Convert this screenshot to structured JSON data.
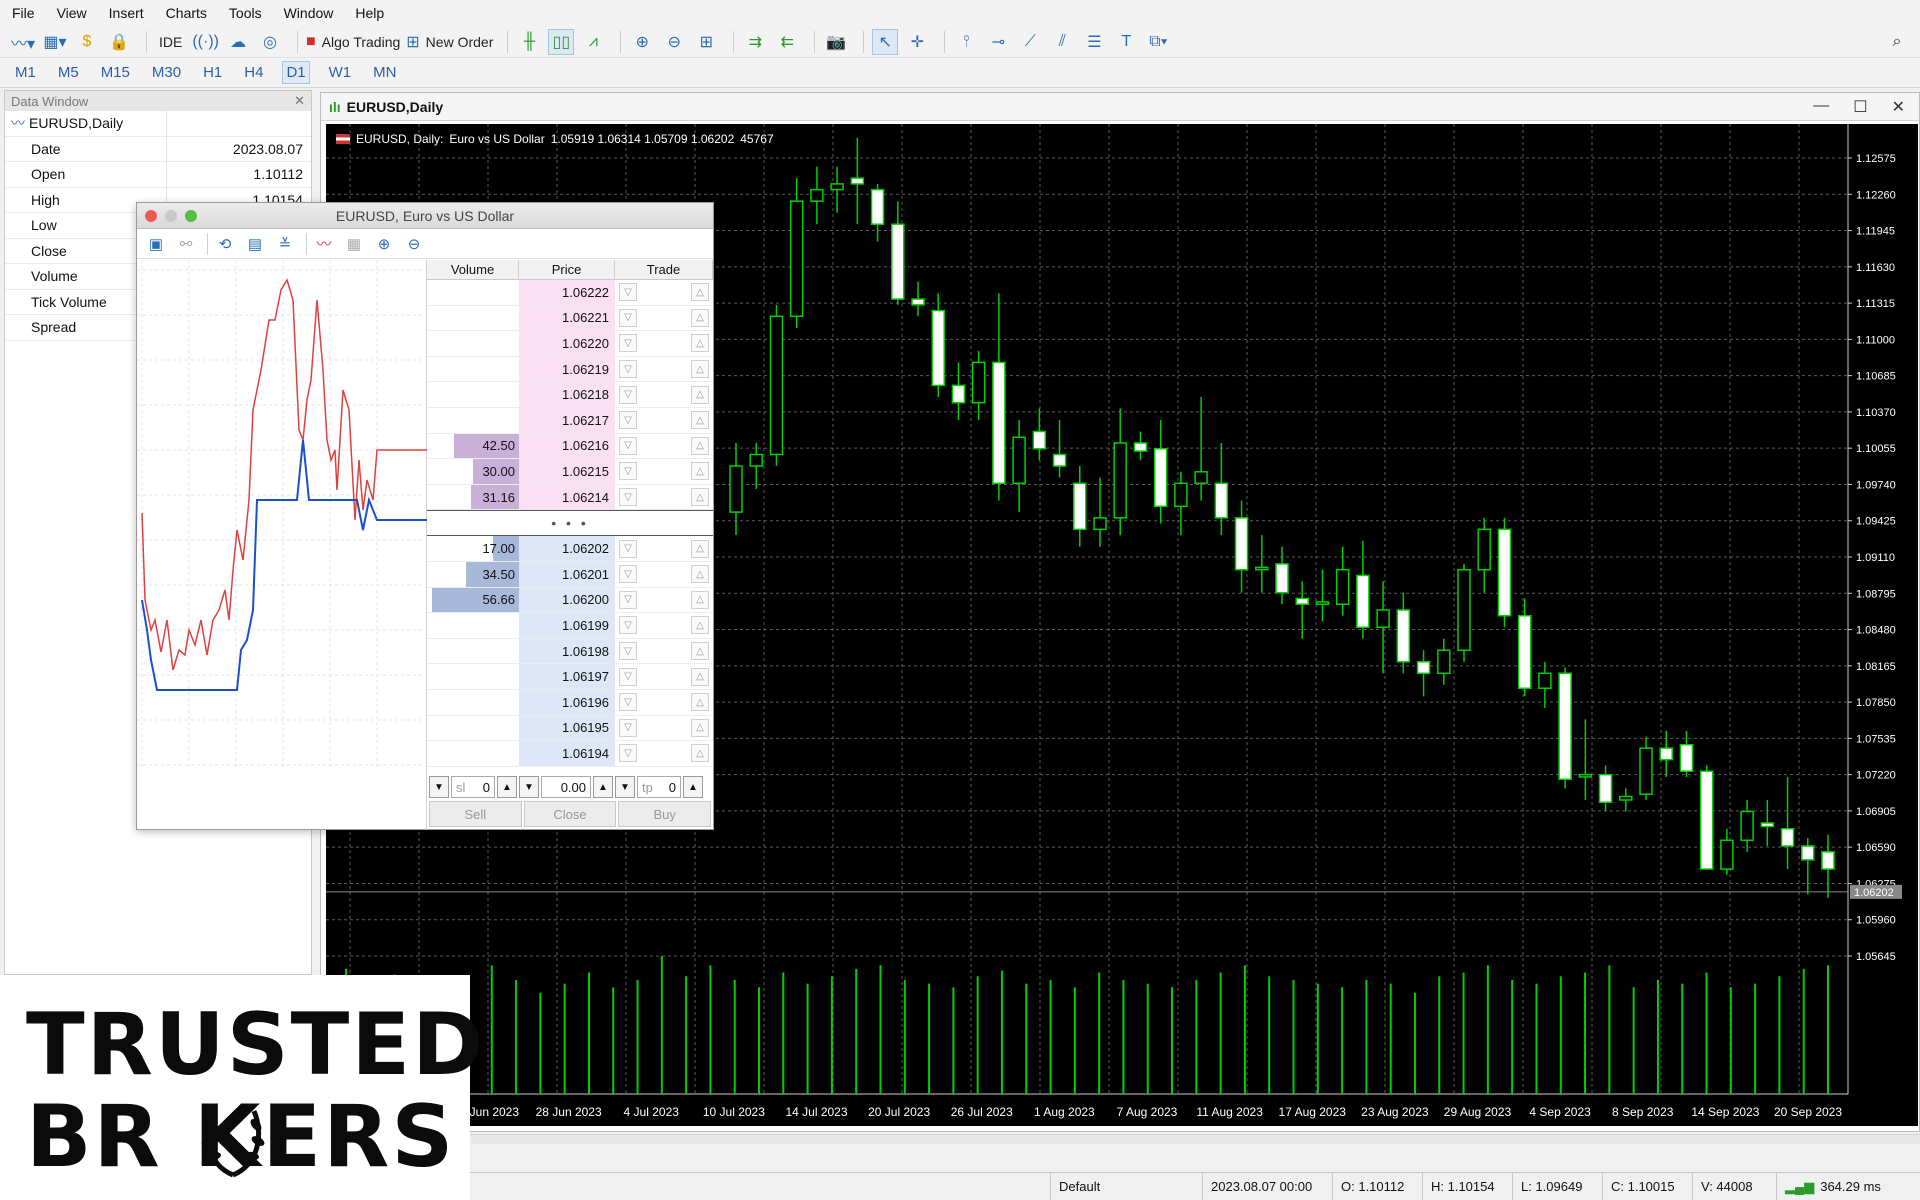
{
  "menu": [
    "File",
    "View",
    "Insert",
    "Charts",
    "Tools",
    "Window",
    "Help"
  ],
  "toolbar": {
    "ide_label": "IDE",
    "algo_trading_label": "Algo Trading",
    "new_order_label": "New Order"
  },
  "timeframes": [
    "M1",
    "M5",
    "M15",
    "M30",
    "H1",
    "H4",
    "D1",
    "W1",
    "MN"
  ],
  "active_timeframe": "D1",
  "data_window": {
    "title": "Data Window",
    "symbol": "EURUSD,Daily",
    "rows": [
      {
        "k": "Date",
        "v": "2023.08.07"
      },
      {
        "k": "Open",
        "v": "1.10112"
      },
      {
        "k": "High",
        "v": "1.10154"
      },
      {
        "k": "Low",
        "v": ""
      },
      {
        "k": "Close",
        "v": ""
      },
      {
        "k": "Volume",
        "v": ""
      },
      {
        "k": "Tick Volume",
        "v": ""
      },
      {
        "k": "Spread",
        "v": ""
      }
    ]
  },
  "chart_window": {
    "title": "EURUSD,Daily",
    "label_symbol": "EURUSD, Daily:",
    "label_desc": "Euro vs US Dollar",
    "label_ohlc": "1.05919 1.06314 1.05709 1.06202",
    "label_vol": "45767",
    "current_price": "1.06202"
  },
  "chart_data": {
    "type": "candlestick",
    "price_ticks": [
      "1.12575",
      "1.12260",
      "1.11945",
      "1.11630",
      "1.11315",
      "1.11000",
      "1.10685",
      "1.10370",
      "1.10055",
      "1.09740",
      "1.09425",
      "1.09110",
      "1.08795",
      "1.08480",
      "1.08165",
      "1.07850",
      "1.07535",
      "1.07220",
      "1.06905",
      "1.06590",
      "1.06275",
      "1.05960",
      "1.05645"
    ],
    "date_ticks": [
      "22 Jun 2023",
      "28 Jun 2023",
      "4 Jul 2023",
      "10 Jul 2023",
      "14 Jul 2023",
      "20 Jul 2023",
      "26 Jul 2023",
      "1 Aug 2023",
      "7 Aug 2023",
      "11 Aug 2023",
      "17 Aug 2023",
      "23 Aug 2023",
      "29 Aug 2023",
      "4 Sep 2023",
      "8 Sep 2023",
      "14 Sep 2023",
      "20 Sep 2023"
    ],
    "candles": [
      {
        "o": 1.095,
        "h": 1.101,
        "l": 1.093,
        "c": 1.099
      },
      {
        "o": 1.099,
        "h": 1.101,
        "l": 1.097,
        "c": 1.1
      },
      {
        "o": 1.1,
        "h": 1.113,
        "l": 1.099,
        "c": 1.112
      },
      {
        "o": 1.112,
        "h": 1.124,
        "l": 1.111,
        "c": 1.122
      },
      {
        "o": 1.122,
        "h": 1.125,
        "l": 1.12,
        "c": 1.123
      },
      {
        "o": 1.123,
        "h": 1.125,
        "l": 1.121,
        "c": 1.1235
      },
      {
        "o": 1.124,
        "h": 1.1275,
        "l": 1.12,
        "c": 1.1235
      },
      {
        "o": 1.123,
        "h": 1.1235,
        "l": 1.1185,
        "c": 1.12
      },
      {
        "o": 1.12,
        "h": 1.122,
        "l": 1.113,
        "c": 1.1135
      },
      {
        "o": 1.1135,
        "h": 1.115,
        "l": 1.112,
        "c": 1.113
      },
      {
        "o": 1.1125,
        "h": 1.114,
        "l": 1.105,
        "c": 1.106
      },
      {
        "o": 1.106,
        "h": 1.108,
        "l": 1.103,
        "c": 1.1045
      },
      {
        "o": 1.1045,
        "h": 1.109,
        "l": 1.103,
        "c": 1.108
      },
      {
        "o": 1.108,
        "h": 1.114,
        "l": 1.096,
        "c": 1.0975
      },
      {
        "o": 1.0975,
        "h": 1.103,
        "l": 1.095,
        "c": 1.1015
      },
      {
        "o": 1.102,
        "h": 1.104,
        "l": 1.0995,
        "c": 1.1005
      },
      {
        "o": 1.1,
        "h": 1.103,
        "l": 1.098,
        "c": 1.099
      },
      {
        "o": 1.0975,
        "h": 1.099,
        "l": 1.092,
        "c": 1.0935
      },
      {
        "o": 1.0935,
        "h": 1.098,
        "l": 1.092,
        "c": 1.0945
      },
      {
        "o": 1.0945,
        "h": 1.104,
        "l": 1.093,
        "c": 1.101
      },
      {
        "o": 1.101,
        "h": 1.102,
        "l": 1.0995,
        "c": 1.1003
      },
      {
        "o": 1.1005,
        "h": 1.103,
        "l": 1.094,
        "c": 1.0955
      },
      {
        "o": 1.0955,
        "h": 1.0985,
        "l": 1.093,
        "c": 1.0975
      },
      {
        "o": 1.0975,
        "h": 1.105,
        "l": 1.096,
        "c": 1.0985
      },
      {
        "o": 1.0975,
        "h": 1.101,
        "l": 1.093,
        "c": 1.0945
      },
      {
        "o": 1.0945,
        "h": 1.096,
        "l": 1.088,
        "c": 1.09
      },
      {
        "o": 1.09,
        "h": 1.093,
        "l": 1.088,
        "c": 1.0902
      },
      {
        "o": 1.0905,
        "h": 1.092,
        "l": 1.087,
        "c": 1.088
      },
      {
        "o": 1.0875,
        "h": 1.089,
        "l": 1.084,
        "c": 1.087
      },
      {
        "o": 1.087,
        "h": 1.09,
        "l": 1.0855,
        "c": 1.0872
      },
      {
        "o": 1.087,
        "h": 1.092,
        "l": 1.086,
        "c": 1.09
      },
      {
        "o": 1.0895,
        "h": 1.0925,
        "l": 1.084,
        "c": 1.085
      },
      {
        "o": 1.085,
        "h": 1.089,
        "l": 1.081,
        "c": 1.0865
      },
      {
        "o": 1.0865,
        "h": 1.088,
        "l": 1.081,
        "c": 1.082
      },
      {
        "o": 1.082,
        "h": 1.083,
        "l": 1.079,
        "c": 1.081
      },
      {
        "o": 1.081,
        "h": 1.084,
        "l": 1.08,
        "c": 1.083
      },
      {
        "o": 1.083,
        "h": 1.0905,
        "l": 1.082,
        "c": 1.09
      },
      {
        "o": 1.09,
        "h": 1.0945,
        "l": 1.088,
        "c": 1.0935
      },
      {
        "o": 1.0935,
        "h": 1.0945,
        "l": 1.085,
        "c": 1.086
      },
      {
        "o": 1.086,
        "h": 1.0875,
        "l": 1.079,
        "c": 1.0797
      },
      {
        "o": 1.0797,
        "h": 1.082,
        "l": 1.078,
        "c": 1.081
      },
      {
        "o": 1.081,
        "h": 1.0815,
        "l": 1.071,
        "c": 1.0718
      },
      {
        "o": 1.072,
        "h": 1.077,
        "l": 1.07,
        "c": 1.0722
      },
      {
        "o": 1.0722,
        "h": 1.073,
        "l": 1.069,
        "c": 1.0698
      },
      {
        "o": 1.07,
        "h": 1.071,
        "l": 1.069,
        "c": 1.0703
      },
      {
        "o": 1.0705,
        "h": 1.0755,
        "l": 1.07,
        "c": 1.0745
      },
      {
        "o": 1.0745,
        "h": 1.076,
        "l": 1.072,
        "c": 1.0735
      },
      {
        "o": 1.0748,
        "h": 1.076,
        "l": 1.072,
        "c": 1.0725
      },
      {
        "o": 1.0725,
        "h": 1.073,
        "l": 1.064,
        "c": 1.064
      },
      {
        "o": 1.064,
        "h": 1.0675,
        "l": 1.0635,
        "c": 1.0665
      },
      {
        "o": 1.0665,
        "h": 1.07,
        "l": 1.0655,
        "c": 1.069
      },
      {
        "o": 1.068,
        "h": 1.07,
        "l": 1.066,
        "c": 1.0677
      },
      {
        "o": 1.0675,
        "h": 1.072,
        "l": 1.064,
        "c": 1.066
      },
      {
        "o": 1.066,
        "h": 1.0667,
        "l": 1.0618,
        "c": 1.0648
      },
      {
        "o": 1.0655,
        "h": 1.067,
        "l": 1.0615,
        "c": 1.064
      }
    ],
    "volumes": [
      0.68,
      0.62,
      0.65,
      0.58,
      0.6,
      0.57,
      0.7,
      0.62,
      0.55,
      0.6,
      0.66,
      0.58,
      0.62,
      0.75,
      0.64,
      0.7,
      0.62,
      0.58,
      0.66,
      0.6,
      0.64,
      0.68,
      0.7,
      0.62,
      0.6,
      0.58,
      0.64,
      0.67,
      0.6,
      0.62,
      0.58,
      0.66,
      0.62,
      0.6,
      0.58,
      0.62,
      0.66,
      0.7,
      0.64,
      0.62,
      0.6,
      0.58,
      0.62,
      0.6,
      0.55,
      0.64,
      0.66,
      0.7,
      0.62,
      0.6,
      0.64,
      0.66,
      0.7,
      0.58,
      0.62,
      0.6,
      0.66,
      0.58,
      0.6,
      0.64,
      0.68,
      0.7
    ]
  },
  "dom": {
    "title": "EURUSD, Euro vs US Dollar",
    "headers": {
      "volume": "Volume",
      "price": "Price",
      "trade": "Trade"
    },
    "asks": [
      {
        "vol": "",
        "price": "1.06222"
      },
      {
        "vol": "",
        "price": "1.06221"
      },
      {
        "vol": "",
        "price": "1.06220"
      },
      {
        "vol": "",
        "price": "1.06219"
      },
      {
        "vol": "",
        "price": "1.06218"
      },
      {
        "vol": "",
        "price": "1.06217"
      },
      {
        "vol": "42.50",
        "price": "1.06216"
      },
      {
        "vol": "30.00",
        "price": "1.06215"
      },
      {
        "vol": "31.16",
        "price": "1.06214"
      }
    ],
    "bids": [
      {
        "vol": "17.00",
        "price": "1.06202"
      },
      {
        "vol": "34.50",
        "price": "1.06201"
      },
      {
        "vol": "56.66",
        "price": "1.06200"
      },
      {
        "vol": "",
        "price": "1.06199"
      },
      {
        "vol": "",
        "price": "1.06198"
      },
      {
        "vol": "",
        "price": "1.06197"
      },
      {
        "vol": "",
        "price": "1.06196"
      },
      {
        "vol": "",
        "price": "1.06195"
      },
      {
        "vol": "",
        "price": "1.06194"
      }
    ],
    "spread_dots": "• • •",
    "sl_label": "sl",
    "sl_value": "0",
    "lot_value": "0.00",
    "tp_label": "tp",
    "tp_value": "0",
    "sell_label": "Sell",
    "close_label": "Close",
    "buy_label": "Buy"
  },
  "status": {
    "profile": "Default",
    "datetime": "2023.08.07 00:00",
    "open": "O: 1.10112",
    "high": "H: 1.10154",
    "low": "L: 1.09649",
    "close": "C: 1.10015",
    "volume": "V: 44008",
    "ping": "364.29 ms"
  },
  "logo": {
    "line1": "TRUSTED",
    "line2": "BR   KERS"
  },
  "colors": {
    "bull": "#00d000",
    "bear": "#ffffff",
    "grid": "#5a5a5a",
    "ask": "#fbe0f3",
    "bid": "#dde7f7"
  }
}
